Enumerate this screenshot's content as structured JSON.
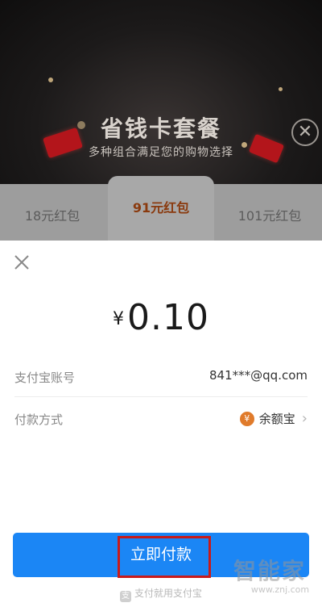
{
  "promo": {
    "title": "省钱卡套餐",
    "subtitle": "多种组合满足您的购物选择",
    "close_glyph": "✕"
  },
  "packages": [
    {
      "label": "18元红包"
    },
    {
      "label": "91元红包",
      "selected": true
    },
    {
      "label": "101元红包"
    }
  ],
  "payment": {
    "currency": "¥",
    "amount": "0.10",
    "account_label": "支付宝账号",
    "account_value": "841***@qq.com",
    "method_label": "付款方式",
    "method_value": "余额宝",
    "method_icon_glyph": "¥",
    "chevron": "›",
    "pay_button": "立即付款"
  },
  "footer": {
    "logo_glyph": "支",
    "text": "支付就用支付宝"
  },
  "watermark": {
    "text": "智能家",
    "url": "www.znj.com"
  },
  "colors": {
    "accent": "#1b86f5",
    "highlight_border": "#c81a1a",
    "selected_tab_text": "#8a3a0e",
    "method_icon": "#e07b2b"
  }
}
